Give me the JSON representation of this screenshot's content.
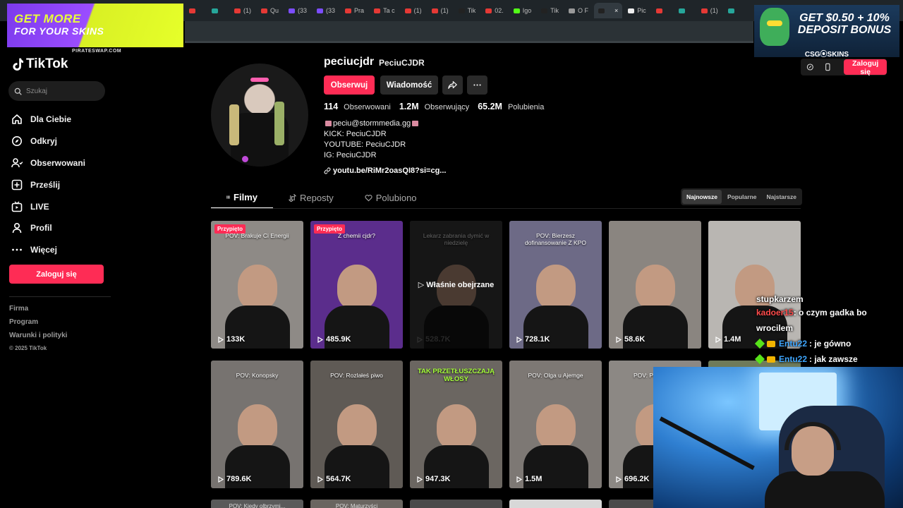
{
  "browser": {
    "tabs": [
      {
        "label": "",
        "color": "#e53935"
      },
      {
        "label": "",
        "color": "#26a69a"
      },
      {
        "label": "(1)",
        "color": "#e53935"
      },
      {
        "label": "Qu",
        "color": "#e53935"
      },
      {
        "label": "(33",
        "color": "#7c4dff"
      },
      {
        "label": "(33",
        "color": "#7c4dff"
      },
      {
        "label": "Pra",
        "color": "#e53935"
      },
      {
        "label": "Ta c",
        "color": "#e53935"
      },
      {
        "label": "(1)",
        "color": "#e53935"
      },
      {
        "label": "(1)",
        "color": "#e53935"
      },
      {
        "label": "Tik",
        "color": "#222222"
      },
      {
        "label": "02.",
        "color": "#e53935"
      },
      {
        "label": "Igo",
        "color": "#53fc18"
      },
      {
        "label": "Tik",
        "color": "#222222"
      },
      {
        "label": "O F",
        "color": "#999999"
      },
      {
        "label": "",
        "color": "#222222",
        "active": true
      },
      {
        "label": "Pic",
        "color": "#eeeeee"
      },
      {
        "label": "",
        "color": "#e53935"
      },
      {
        "label": "",
        "color": "#26a69a"
      },
      {
        "label": "(1)",
        "color": "#e53935"
      },
      {
        "label": "",
        "color": "#26a69a"
      }
    ],
    "close_glyph": "×"
  },
  "ads": {
    "left": {
      "line1": "GET MORE",
      "line2": "FOR YOUR SKINS",
      "brand": "PIRATESWAP.COM"
    },
    "right": {
      "line1": "GET $0.50 + 10%",
      "line2": "DEPOSIT BONUS",
      "brand": "CSG⦿SKINS"
    }
  },
  "sidebar": {
    "logo": "TikTok",
    "search_placeholder": "Szukaj",
    "items": [
      {
        "label": "Dla Ciebie",
        "icon": "home-icon"
      },
      {
        "label": "Odkryj",
        "icon": "compass-icon"
      },
      {
        "label": "Obserwowani",
        "icon": "user-follow-icon"
      },
      {
        "label": "Prześlij",
        "icon": "upload-icon"
      },
      {
        "label": "LIVE",
        "icon": "live-icon"
      },
      {
        "label": "Profil",
        "icon": "profile-icon"
      },
      {
        "label": "Więcej",
        "icon": "more-icon"
      }
    ],
    "login_label": "Zaloguj się",
    "footer": [
      "Firma",
      "Program",
      "Warunki i polityki"
    ],
    "copyright": "© 2025 TikTok"
  },
  "header_right": {
    "login_label": "Zaloguj się"
  },
  "profile": {
    "username": "peciucjdr",
    "nickname": "PeciuCJDR",
    "follow_label": "Obserwuj",
    "message_label": "Wiadomość",
    "stats": [
      {
        "value": "114",
        "label": "Obserwowani"
      },
      {
        "value": "1.2M",
        "label": "Obserwujący"
      },
      {
        "value": "65.2M",
        "label": "Polubienia"
      }
    ],
    "bio": [
      "peciu@stormmedia.gg",
      "KICK: PeciuCJDR",
      "YOUTUBE: PeciuCJDR",
      "IG: PeciuCJDR"
    ],
    "link": "youtu.be/RiMr2oasQI8?si=cg..."
  },
  "tabs": [
    {
      "label": "Filmy",
      "active": true
    },
    {
      "label": "Reposty"
    },
    {
      "label": "Polubiono"
    }
  ],
  "sort": [
    {
      "label": "Najnowsze",
      "active": true
    },
    {
      "label": "Popularne"
    },
    {
      "label": "Najstarsze"
    }
  ],
  "videos": [
    {
      "views": "133K",
      "caption": "POV: Brakuje Ci Energii",
      "pinned": "Przypięto",
      "bg": "#8e8a86"
    },
    {
      "views": "485.9K",
      "caption": "Z chemii cjdr?",
      "pinned": "Przypięto",
      "bg": "#5b2d8c"
    },
    {
      "views": "528.7K",
      "caption": "Lekarz zabrania dymić w niedzielę",
      "watched": "Właśnie obejrzane",
      "bg": "#3a3a3a"
    },
    {
      "views": "728.1K",
      "caption": "POV: Bierzesz dofinansowanie Z KPO",
      "bg": "#6d6a86"
    },
    {
      "views": "58.6K",
      "caption": "",
      "bg": "#8a8580"
    },
    {
      "views": "1.4M",
      "caption": "",
      "bg": "#b9b6b2"
    },
    {
      "views": "789.6K",
      "caption": "POV: Konopsky",
      "bg": "#777370"
    },
    {
      "views": "564.7K",
      "caption": "POV: Rozlałeś piwo",
      "bg": "#5f5a55"
    },
    {
      "views": "947.3K",
      "caption": "TAK PRZETŁUSZCZAJĄ WŁOSY",
      "big": true,
      "bg": "#6b6661"
    },
    {
      "views": "1.5M",
      "caption": "POV: Olga u Ajemge",
      "bg": "#7d7874"
    },
    {
      "views": "696.2K",
      "caption": "POV: Polac wyb",
      "bg": "#8c8884"
    },
    {
      "views": "",
      "caption": "",
      "bg": "#6f7b5a"
    }
  ],
  "row3_captions": [
    "POV: Kiedy olbrzymi...",
    "POV: Maturzyści",
    "",
    "",
    ""
  ],
  "chat": [
    {
      "user": "",
      "text": "stupkarzem",
      "color": "#ffffff"
    },
    {
      "user": "kadoer15",
      "text": ": o czym gadka bo wrocilem",
      "color": "#ff4b4b"
    },
    {
      "user": "Entu22",
      "text": ": je gówno",
      "color": "#3ea6ff",
      "badges": true
    },
    {
      "user": "Entu22",
      "text": ": jak zawsze",
      "color": "#3ea6ff",
      "badges": true
    }
  ]
}
